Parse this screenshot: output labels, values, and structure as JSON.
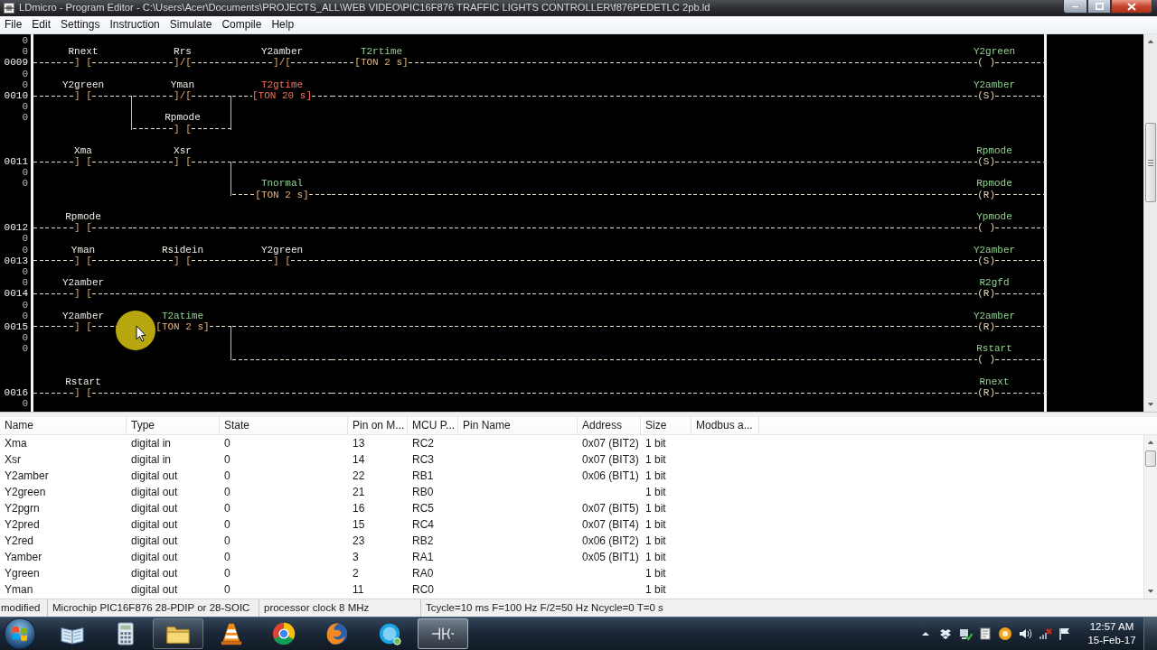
{
  "window": {
    "title": "LDmicro - Program Editor - C:\\Users\\Acer\\Documents\\PROJECTS_ALL\\WEB VIDEO\\PIC16F876 TRAFFIC LIGHTS CONTROLLER\\f876PEDETLC 2pb.ld"
  },
  "menu": [
    "File",
    "Edit",
    "Settings",
    "Instruction",
    "Simulate",
    "Compile",
    "Help"
  ],
  "ladder": {
    "rungs": [
      {
        "number": "0009",
        "branches": [
          {
            "gutter": [
              "0",
              "0"
            ],
            "cells": [
              {
                "kind": "contact",
                "name": "Rnext",
                "symbol": "] [",
                "selected": false
              },
              {
                "kind": "contact",
                "name": "Rrs",
                "symbol": "]/[",
                "selected": false
              },
              {
                "kind": "contact",
                "name": "Y2amber",
                "symbol": "]/[",
                "selected": false
              },
              {
                "kind": "timer",
                "name": "T2rtime",
                "symbol": "[TON 2 s]",
                "selected": false
              }
            ],
            "coil": {
              "name": "Y2green",
              "symbol": "( )",
              "selected": false
            }
          }
        ]
      },
      {
        "number": "0010",
        "branches": [
          {
            "gutter": [
              "0",
              "0"
            ],
            "cells": [
              {
                "kind": "contact",
                "name": "Y2green",
                "symbol": "] [",
                "selected": false
              },
              {
                "kind": "contact",
                "name": "Yman",
                "symbol": "]/[",
                "selected": false
              },
              {
                "kind": "timer",
                "name": "T2gtime",
                "symbol": "[TON 20 s]",
                "selected": true
              }
            ],
            "coil": {
              "name": "Y2amber",
              "symbol": "(S)",
              "selected": false
            }
          },
          {
            "gutter": [
              "0",
              "0"
            ],
            "cells": [
              null,
              {
                "kind": "contact",
                "name": "Rpmode",
                "symbol": "] [",
                "selected": false
              }
            ]
          }
        ]
      },
      {
        "number": "0011",
        "branches": [
          {
            "cells": [
              {
                "kind": "contact",
                "name": "Xma",
                "symbol": "] [",
                "selected": false
              },
              {
                "kind": "contact",
                "name": "Xsr",
                "symbol": "] [",
                "selected": false
              }
            ],
            "coil": {
              "name": "Rpmode",
              "symbol": "(S)",
              "selected": false
            }
          },
          {
            "gutter": [
              "0",
              "0"
            ],
            "cells": [
              null,
              null,
              {
                "kind": "timer",
                "name": "Tnormal",
                "symbol": "[TON 2 s]",
                "selected": false
              }
            ],
            "coil": {
              "name": "Rpmode",
              "symbol": "(R)",
              "selected": false
            }
          }
        ]
      },
      {
        "number": "0012",
        "branches": [
          {
            "cells": [
              {
                "kind": "contact",
                "name": "Rpmode",
                "symbol": "] [",
                "selected": false
              }
            ],
            "coil": {
              "name": "Ypmode",
              "symbol": "( )",
              "selected": false
            }
          }
        ]
      },
      {
        "number": "0013",
        "branches": [
          {
            "gutter": [
              "0",
              "0"
            ],
            "cells": [
              {
                "kind": "contact",
                "name": "Yman",
                "symbol": "] [",
                "selected": false
              },
              {
                "kind": "contact",
                "name": "Rsidein",
                "symbol": "] [",
                "selected": false
              },
              {
                "kind": "contact",
                "name": "Y2green",
                "symbol": "] [",
                "selected": false
              }
            ],
            "coil": {
              "name": "Y2amber",
              "symbol": "(S)",
              "selected": false
            }
          }
        ]
      },
      {
        "number": "0014",
        "branches": [
          {
            "gutter": [
              "0",
              "0"
            ],
            "cells": [
              {
                "kind": "contact",
                "name": "Y2amber",
                "symbol": "] [",
                "selected": false
              }
            ],
            "coil": {
              "name": "R2gfd",
              "symbol": "(R)",
              "selected": false
            }
          }
        ]
      },
      {
        "number": "0015",
        "branches": [
          {
            "gutter": [
              "0",
              "0"
            ],
            "cells": [
              {
                "kind": "contact",
                "name": "Y2amber",
                "symbol": "] [",
                "selected": false
              },
              {
                "kind": "timer",
                "name": "T2atime",
                "symbol": "[TON 2 s]",
                "selected": false
              }
            ],
            "coil": {
              "name": "Y2amber",
              "symbol": "(R)",
              "selected": false
            }
          },
          {
            "gutter": [
              "0",
              "0"
            ],
            "cells": [
              null,
              null
            ],
            "coil": {
              "name": "Rstart",
              "symbol": "( )",
              "selected": false
            }
          }
        ]
      },
      {
        "number": "0016",
        "branches": [
          {
            "cells": [
              {
                "kind": "contact",
                "name": "Rstart",
                "symbol": "] [",
                "selected": false
              }
            ],
            "coil": {
              "name": "Rnext",
              "symbol": "(R)",
              "selected": false
            }
          }
        ]
      },
      {
        "branches": [
          {
            "gutter": [
              "0"
            ]
          }
        ]
      }
    ]
  },
  "io_list": {
    "columns": [
      "Name",
      "Type",
      "State",
      "Pin on M...",
      "MCU P...",
      "Pin Name",
      "Address",
      "Size",
      "Modbus a..."
    ],
    "rows": [
      [
        "Xma",
        "digital in",
        "0",
        "13",
        "RC2",
        null,
        "0x07 (BIT2)",
        "1 bit",
        null
      ],
      [
        "Xsr",
        "digital in",
        "0",
        "14",
        "RC3",
        null,
        "0x07 (BIT3)",
        "1 bit",
        null
      ],
      [
        "Y2amber",
        "digital out",
        "0",
        "22",
        "RB1",
        null,
        "0x06 (BIT1)",
        "1 bit",
        null
      ],
      [
        "Y2green",
        "digital out",
        "0",
        "21",
        "RB0",
        null,
        null,
        "1 bit",
        null
      ],
      [
        "Y2pgrn",
        "digital out",
        "0",
        "16",
        "RC5",
        null,
        "0x07 (BIT5)",
        "1 bit",
        null
      ],
      [
        "Y2pred",
        "digital out",
        "0",
        "15",
        "RC4",
        null,
        "0x07 (BIT4)",
        "1 bit",
        null
      ],
      [
        "Y2red",
        "digital out",
        "0",
        "23",
        "RB2",
        null,
        "0x06 (BIT2)",
        "1 bit",
        null
      ],
      [
        "Yamber",
        "digital out",
        "0",
        "3",
        "RA1",
        null,
        "0x05 (BIT1)",
        "1 bit",
        null
      ],
      [
        "Ygreen",
        "digital out",
        "0",
        "2",
        "RA0",
        null,
        null,
        "1 bit",
        null
      ],
      [
        "Yman",
        "digital out",
        "0",
        "11",
        "RC0",
        null,
        null,
        "1 bit",
        null
      ]
    ]
  },
  "status_bar": [
    "modified",
    "Microchip PIC16F876 28-PDIP or 28-SOIC",
    "processor clock 8 MHz",
    "Tcycle=10 ms F=100 Hz F/2=50 Hz Ncycle=0 T=0 s"
  ],
  "taskbar": {
    "apps": [
      {
        "kind": "book",
        "running": false,
        "selected": false
      },
      {
        "kind": "calculator",
        "running": false,
        "selected": false
      },
      {
        "kind": "folder",
        "running": true,
        "selected": false
      },
      {
        "kind": "cone",
        "running": false,
        "selected": false
      },
      {
        "kind": "wheel",
        "running": false,
        "selected": false
      },
      {
        "kind": "globe",
        "running": false,
        "selected": false
      },
      {
        "kind": "bubble",
        "running": false,
        "selected": false
      },
      {
        "kind": "ladder",
        "running": true,
        "selected": true
      }
    ],
    "clock": {
      "time": "12:57 AM",
      "date": "15-Feb-17"
    }
  }
}
